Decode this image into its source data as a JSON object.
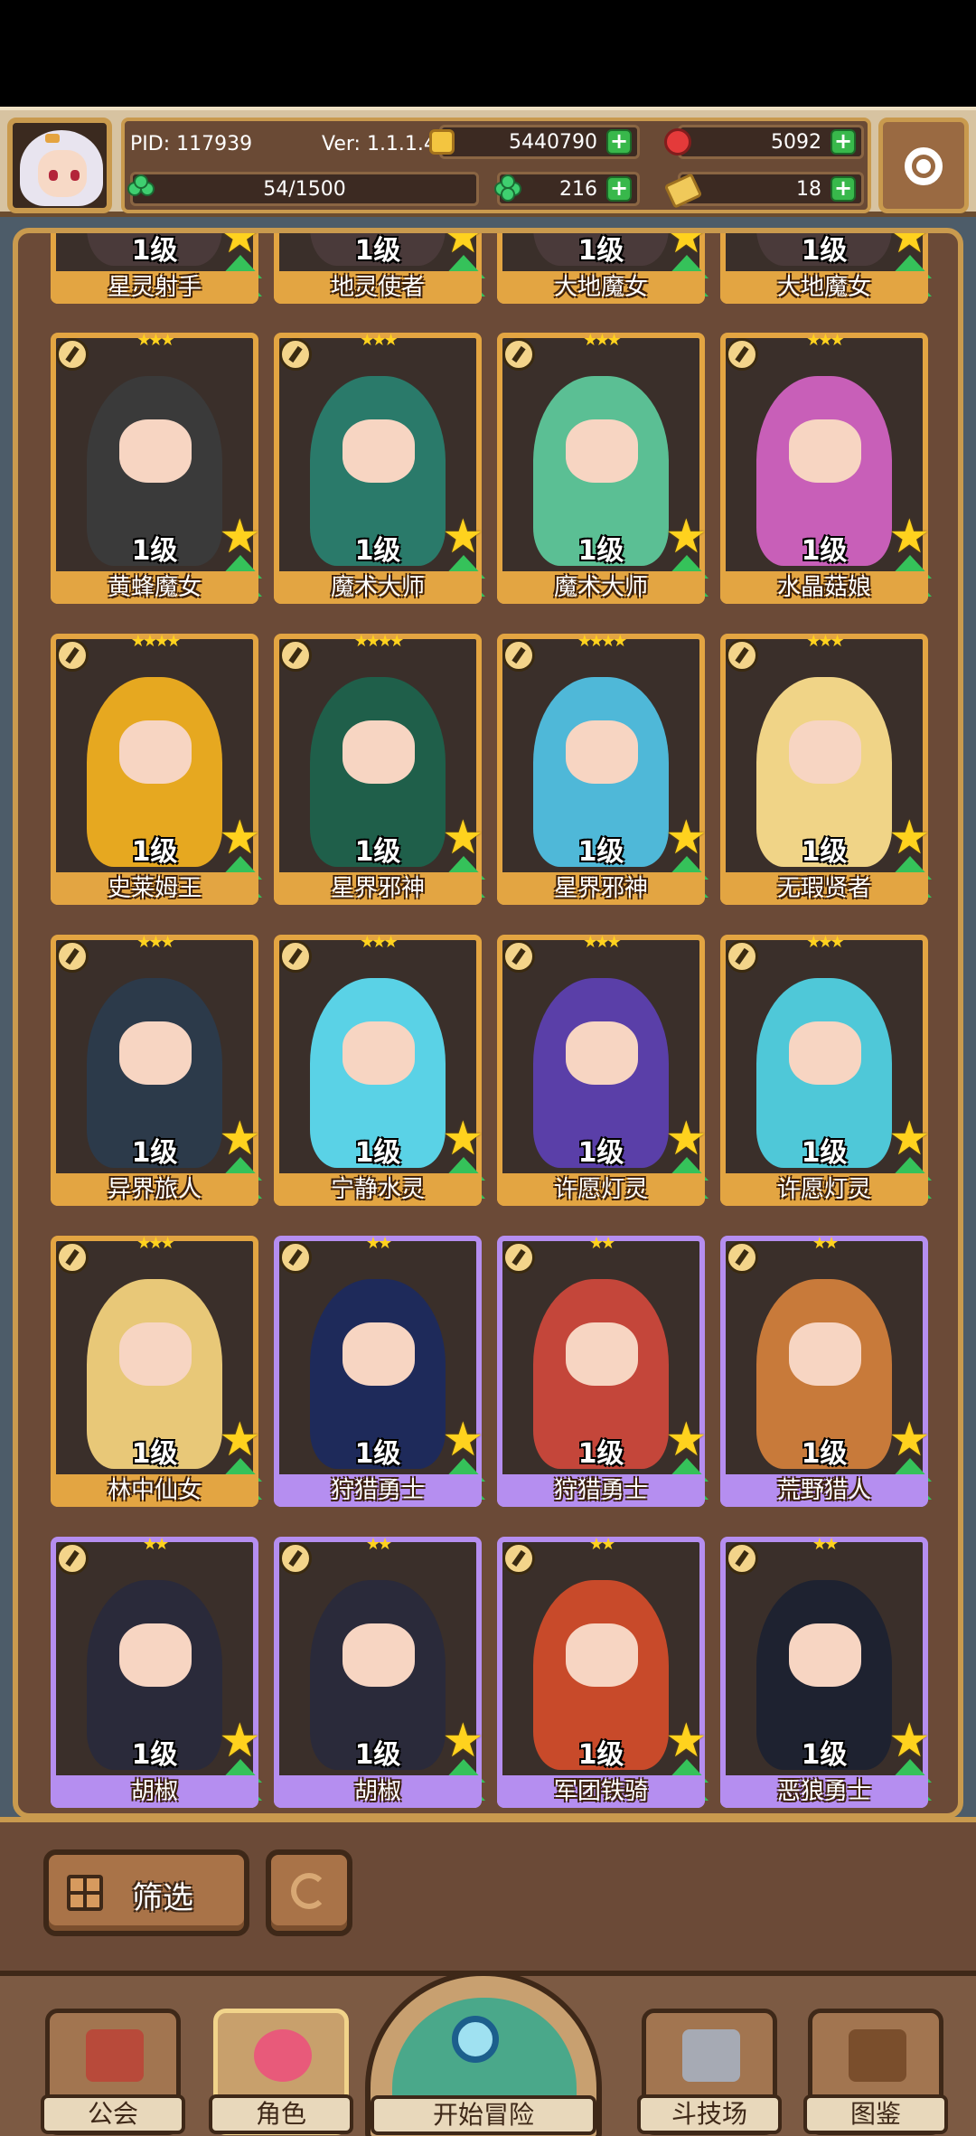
{
  "header": {
    "pid": "PID: 117939",
    "version": "Ver: 1.1.1.4",
    "gold": "5440790",
    "gems": "5092",
    "energy": "54/1500",
    "clover": "216",
    "tickets": "18"
  },
  "cards_top_row": [
    {
      "level": "1级",
      "name": "星灵射手",
      "frame": "gold"
    },
    {
      "level": "1级",
      "name": "地灵使者",
      "frame": "gold"
    },
    {
      "level": "1级",
      "name": "大地魔女",
      "frame": "gold"
    },
    {
      "level": "1级",
      "name": "大地魔女",
      "frame": "gold"
    }
  ],
  "cards": [
    {
      "level": "1级",
      "name": "黄蜂魔女",
      "stars": "★★★",
      "frame": "gold",
      "color": "#3a3a3a"
    },
    {
      "level": "1级",
      "name": "魔术大师",
      "stars": "★★★",
      "frame": "gold",
      "color": "#2a7a6a"
    },
    {
      "level": "1级",
      "name": "魔术大师",
      "stars": "★★★",
      "frame": "gold",
      "color": "#5bbf94"
    },
    {
      "level": "1级",
      "name": "水晶菇娘",
      "stars": "★★★",
      "frame": "gold",
      "color": "#c85fb8"
    },
    {
      "level": "1级",
      "name": "史莱姆王",
      "stars": "★★★★",
      "frame": "gold",
      "color": "#e6a820"
    },
    {
      "level": "1级",
      "name": "星界邪神",
      "stars": "★★★★",
      "frame": "gold",
      "color": "#1f5f4a"
    },
    {
      "level": "1级",
      "name": "星界邪神",
      "stars": "★★★★",
      "frame": "gold",
      "color": "#4fb8d8"
    },
    {
      "level": "1级",
      "name": "无瑕贤者",
      "stars": "★★★",
      "frame": "gold",
      "color": "#f0d487"
    },
    {
      "level": "1级",
      "name": "异界旅人",
      "stars": "★★★",
      "frame": "gold",
      "color": "#2c3a4a"
    },
    {
      "level": "1级",
      "name": "宁静水灵",
      "stars": "★★★",
      "frame": "gold",
      "color": "#5ad2e6"
    },
    {
      "level": "1级",
      "name": "许愿灯灵",
      "stars": "★★★",
      "frame": "gold",
      "color": "#5a3fa8"
    },
    {
      "level": "1级",
      "name": "许愿灯灵",
      "stars": "★★★",
      "frame": "gold",
      "color": "#4fc8d8"
    },
    {
      "level": "1级",
      "name": "林中仙女",
      "stars": "★★★",
      "frame": "gold",
      "color": "#e8c878"
    },
    {
      "level": "1级",
      "name": "狩猎勇士",
      "stars": "★★",
      "frame": "purple",
      "color": "#1e2a5a"
    },
    {
      "level": "1级",
      "name": "狩猎勇士",
      "stars": "★★",
      "frame": "purple",
      "color": "#c4463a"
    },
    {
      "level": "1级",
      "name": "荒野猎人",
      "stars": "★★",
      "frame": "purple",
      "color": "#c87a3a"
    },
    {
      "level": "1级",
      "name": "胡椒",
      "stars": "★★",
      "frame": "purple",
      "color": "#2a2a3a"
    },
    {
      "level": "1级",
      "name": "胡椒",
      "stars": "★★",
      "frame": "purple",
      "color": "#2a2a3a"
    },
    {
      "level": "1级",
      "name": "军团铁骑",
      "stars": "★★",
      "frame": "purple",
      "color": "#c84a2a"
    },
    {
      "level": "1级",
      "name": "恶狼勇士",
      "stars": "★★",
      "frame": "purple",
      "color": "#1e2230"
    }
  ],
  "controls": {
    "filter_label": "筛选"
  },
  "nav": {
    "guild": "公会",
    "character": "角色",
    "adventure": "开始冒险",
    "arena": "斗技场",
    "codex": "图鉴"
  },
  "colors": {
    "gold_frame": "#e3a542",
    "purple_frame": "#b58ef0",
    "panel_bg": "#6b4a37"
  }
}
